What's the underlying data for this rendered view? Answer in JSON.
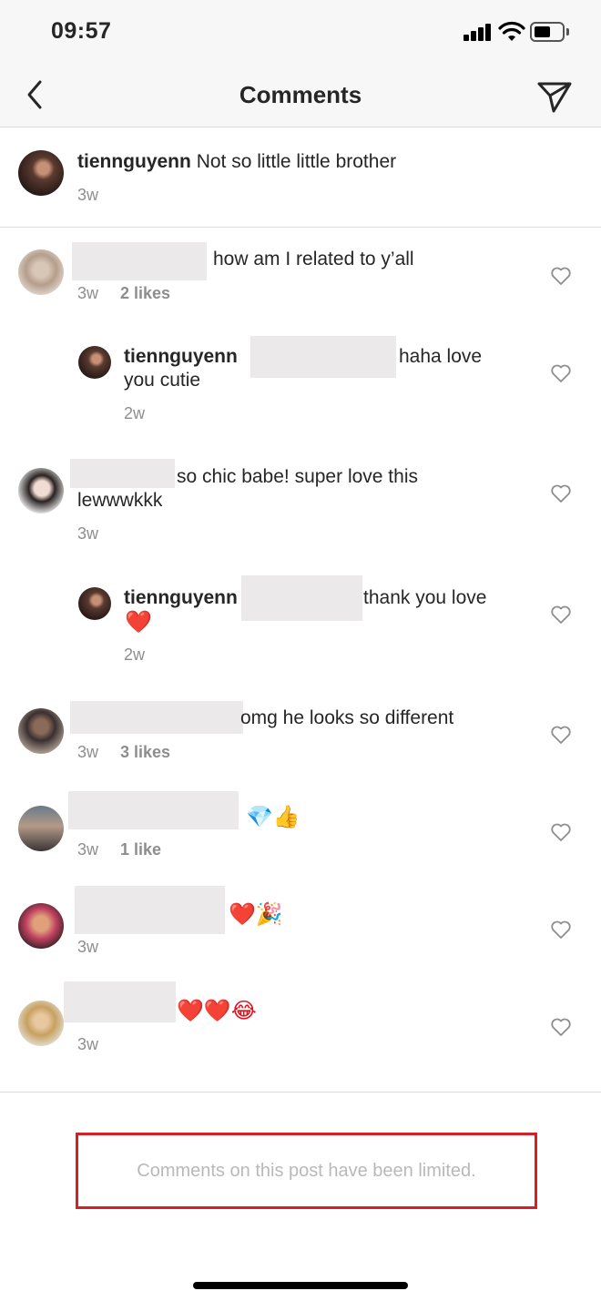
{
  "status": {
    "time": "09:57"
  },
  "nav": {
    "title": "Comments",
    "back_icon": "chevron-left-icon",
    "send_icon": "paper-plane-icon"
  },
  "caption": {
    "username": "tiennguyenn",
    "text": "Not so little little brother",
    "time": "3w"
  },
  "comments": [
    {
      "text": "how am I related to y’all",
      "time": "3w",
      "likes": "2 likes"
    },
    {
      "username": "tiennguyenn",
      "text_line1": "haha love",
      "text_line2": "you cutie",
      "time": "2w"
    },
    {
      "text_line1": "so chic babe! super love this",
      "text_line2": "lewwwkkk",
      "time": "3w"
    },
    {
      "username": "tiennguyenn",
      "text_line1": "thank you love",
      "text_line2": "❤️",
      "time": "2w"
    },
    {
      "text": "omg he looks so different",
      "time": "3w",
      "likes": "3 likes"
    },
    {
      "text": "💎👍",
      "time": "3w",
      "likes": "1 like"
    },
    {
      "text": "❤️🎉",
      "time": "3w"
    },
    {
      "text": "❤️❤️😂",
      "time": "3w"
    }
  ],
  "footer": {
    "limited": "Comments on this post have been limited."
  },
  "colors": {
    "redaction": "#ebe9ea",
    "limited_border": "#d71f26",
    "meta_gray": "#8e8e8e"
  }
}
